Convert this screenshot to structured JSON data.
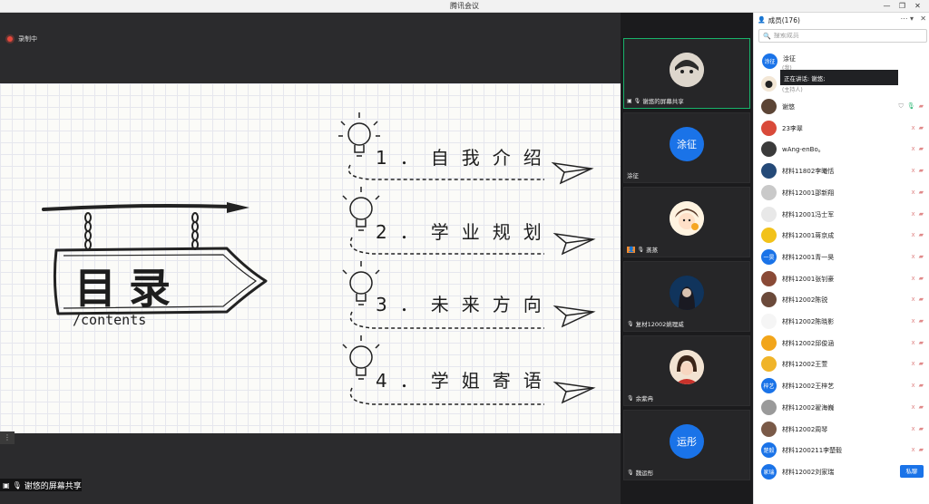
{
  "window": {
    "title": "腾讯会议"
  },
  "recording": {
    "label": "录制中"
  },
  "slide": {
    "sign_title": "目录",
    "sign_subtitle": "/contents",
    "toc": [
      "1．自我介绍",
      "2．学业规划",
      "3．未来方向",
      "4．学姐寄语"
    ]
  },
  "sharer_bar": {
    "label": "谢悠的屏幕共享"
  },
  "gallery": {
    "tiles": [
      {
        "name": "谢悠的屏幕共享",
        "avatar": ""
      },
      {
        "name": "涂征",
        "avatar": "涂征"
      },
      {
        "name": "蒸蒸",
        "avatar": ""
      },
      {
        "name": "复材12002姚理威",
        "avatar": ""
      },
      {
        "name": "余紫冉",
        "avatar": ""
      },
      {
        "name": "魏运彤",
        "avatar": "运彤"
      }
    ]
  },
  "panel": {
    "title": "成员(176)",
    "search_placeholder": "搜索成员",
    "host_avatar": "涂征",
    "host_name": "涂征",
    "host_role_line": "(我)",
    "cohost_role_line": "(主持人)",
    "speaking_tooltip": "正在讲话: 谢悠;",
    "private_chat_label": "私聊",
    "members": [
      {
        "name": "谢悠",
        "avatar": ""
      },
      {
        "name": "23李翠",
        "avatar": ""
      },
      {
        "name": "wAng-enBo。",
        "avatar": ""
      },
      {
        "name": "材料11802李曦恬",
        "avatar": ""
      },
      {
        "name": "材料12001邵新翔",
        "avatar": ""
      },
      {
        "name": "材料12001冯士军",
        "avatar": ""
      },
      {
        "name": "材料12001蒋京成",
        "avatar": ""
      },
      {
        "name": "材料12001青一昊",
        "avatar": "一昊"
      },
      {
        "name": "材料12001张钊豪",
        "avatar": ""
      },
      {
        "name": "材料12002陈锐",
        "avatar": ""
      },
      {
        "name": "材料12002陈晓影",
        "avatar": ""
      },
      {
        "name": "材料12002邱俊涵",
        "avatar": ""
      },
      {
        "name": "材料12002王萱",
        "avatar": ""
      },
      {
        "name": "材料12002王梓艺",
        "avatar": "梓艺"
      },
      {
        "name": "材料12002翟海巍",
        "avatar": ""
      },
      {
        "name": "材料12002周琴",
        "avatar": ""
      },
      {
        "name": "材料1200211李楚毅",
        "avatar": "楚毅"
      },
      {
        "name": "材料12002刘家瑞",
        "avatar": "家瑞"
      }
    ]
  },
  "colors": {
    "accent": "#1a73e8",
    "active_border": "#18b36b",
    "muted": "#e08a8a",
    "record": "#e5483c"
  }
}
